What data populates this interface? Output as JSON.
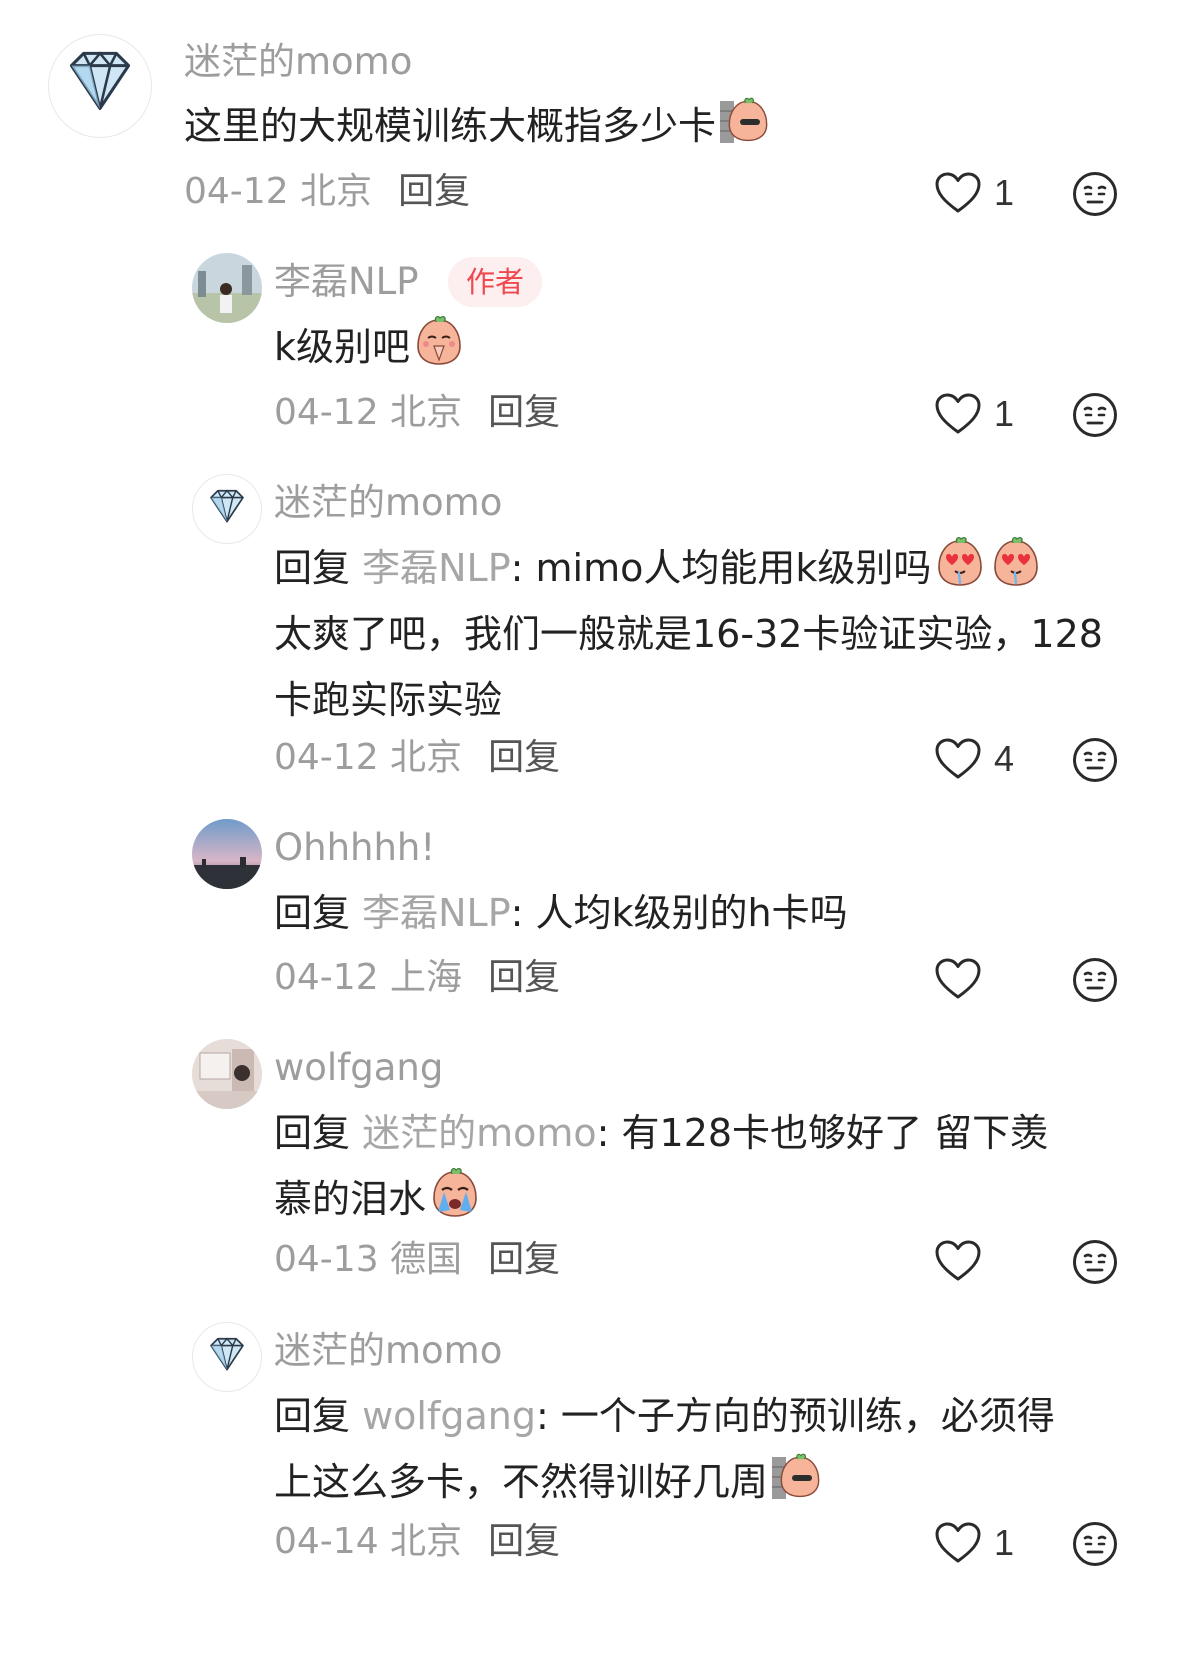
{
  "comments": [
    {
      "username": "迷茫的momo",
      "body": "这里的大规模训练大概指多少卡",
      "emoji": "wall-peek-emoji",
      "date": "04-12 北京",
      "reply_label": "回复",
      "likes": "1"
    },
    {
      "username": "李磊NLP",
      "author_tag": "作者",
      "body": "k级别吧",
      "emoji": "praying-emoji",
      "date": "04-12 北京",
      "reply_label": "回复",
      "likes": "1"
    },
    {
      "username": "迷茫的momo",
      "reply_prefix": "回复 ",
      "mention": "李磊NLP",
      "body_line1": ": mimo人均能用k级别吗",
      "body_rest": "太爽了吧，我们一般就是16-32卡验证实验，128卡跑实际实验",
      "emoji": "heart-eyes-emoji",
      "date": "04-12 北京",
      "reply_label": "回复",
      "likes": "4"
    },
    {
      "username": "Ohhhhh!",
      "reply_prefix": "回复 ",
      "mention": "李磊NLP",
      "body": ": 人均k级别的h卡吗",
      "date": "04-12 上海",
      "reply_label": "回复",
      "likes": ""
    },
    {
      "username": "wolfgang",
      "reply_prefix": "回复 ",
      "mention": "迷茫的momo",
      "body_line1": ": 有128卡也够好了 留下羡",
      "body_line2": "慕的泪水",
      "emoji": "crying-emoji",
      "date": "04-13 德国",
      "reply_label": "回复",
      "likes": ""
    },
    {
      "username": "迷茫的momo",
      "reply_prefix": "回复 ",
      "mention": "wolfgang",
      "body_line1": ": 一个子方向的预训练，必须得",
      "body_line2": "上这么多卡，不然得训好几周",
      "emoji": "wall-peek-emoji",
      "date": "04-14 北京",
      "reply_label": "回复",
      "likes": "1"
    }
  ],
  "colors": {
    "username": "#9d9d9d",
    "mention": "#a6a6a6",
    "author_tag_bg": "#fdeef0",
    "author_tag_text": "#f0484f",
    "body_text": "#222222"
  },
  "icons": {
    "like": "heart-outline-icon",
    "react": "neutral-face-icon",
    "avatar_momo": "diamond-icon"
  }
}
